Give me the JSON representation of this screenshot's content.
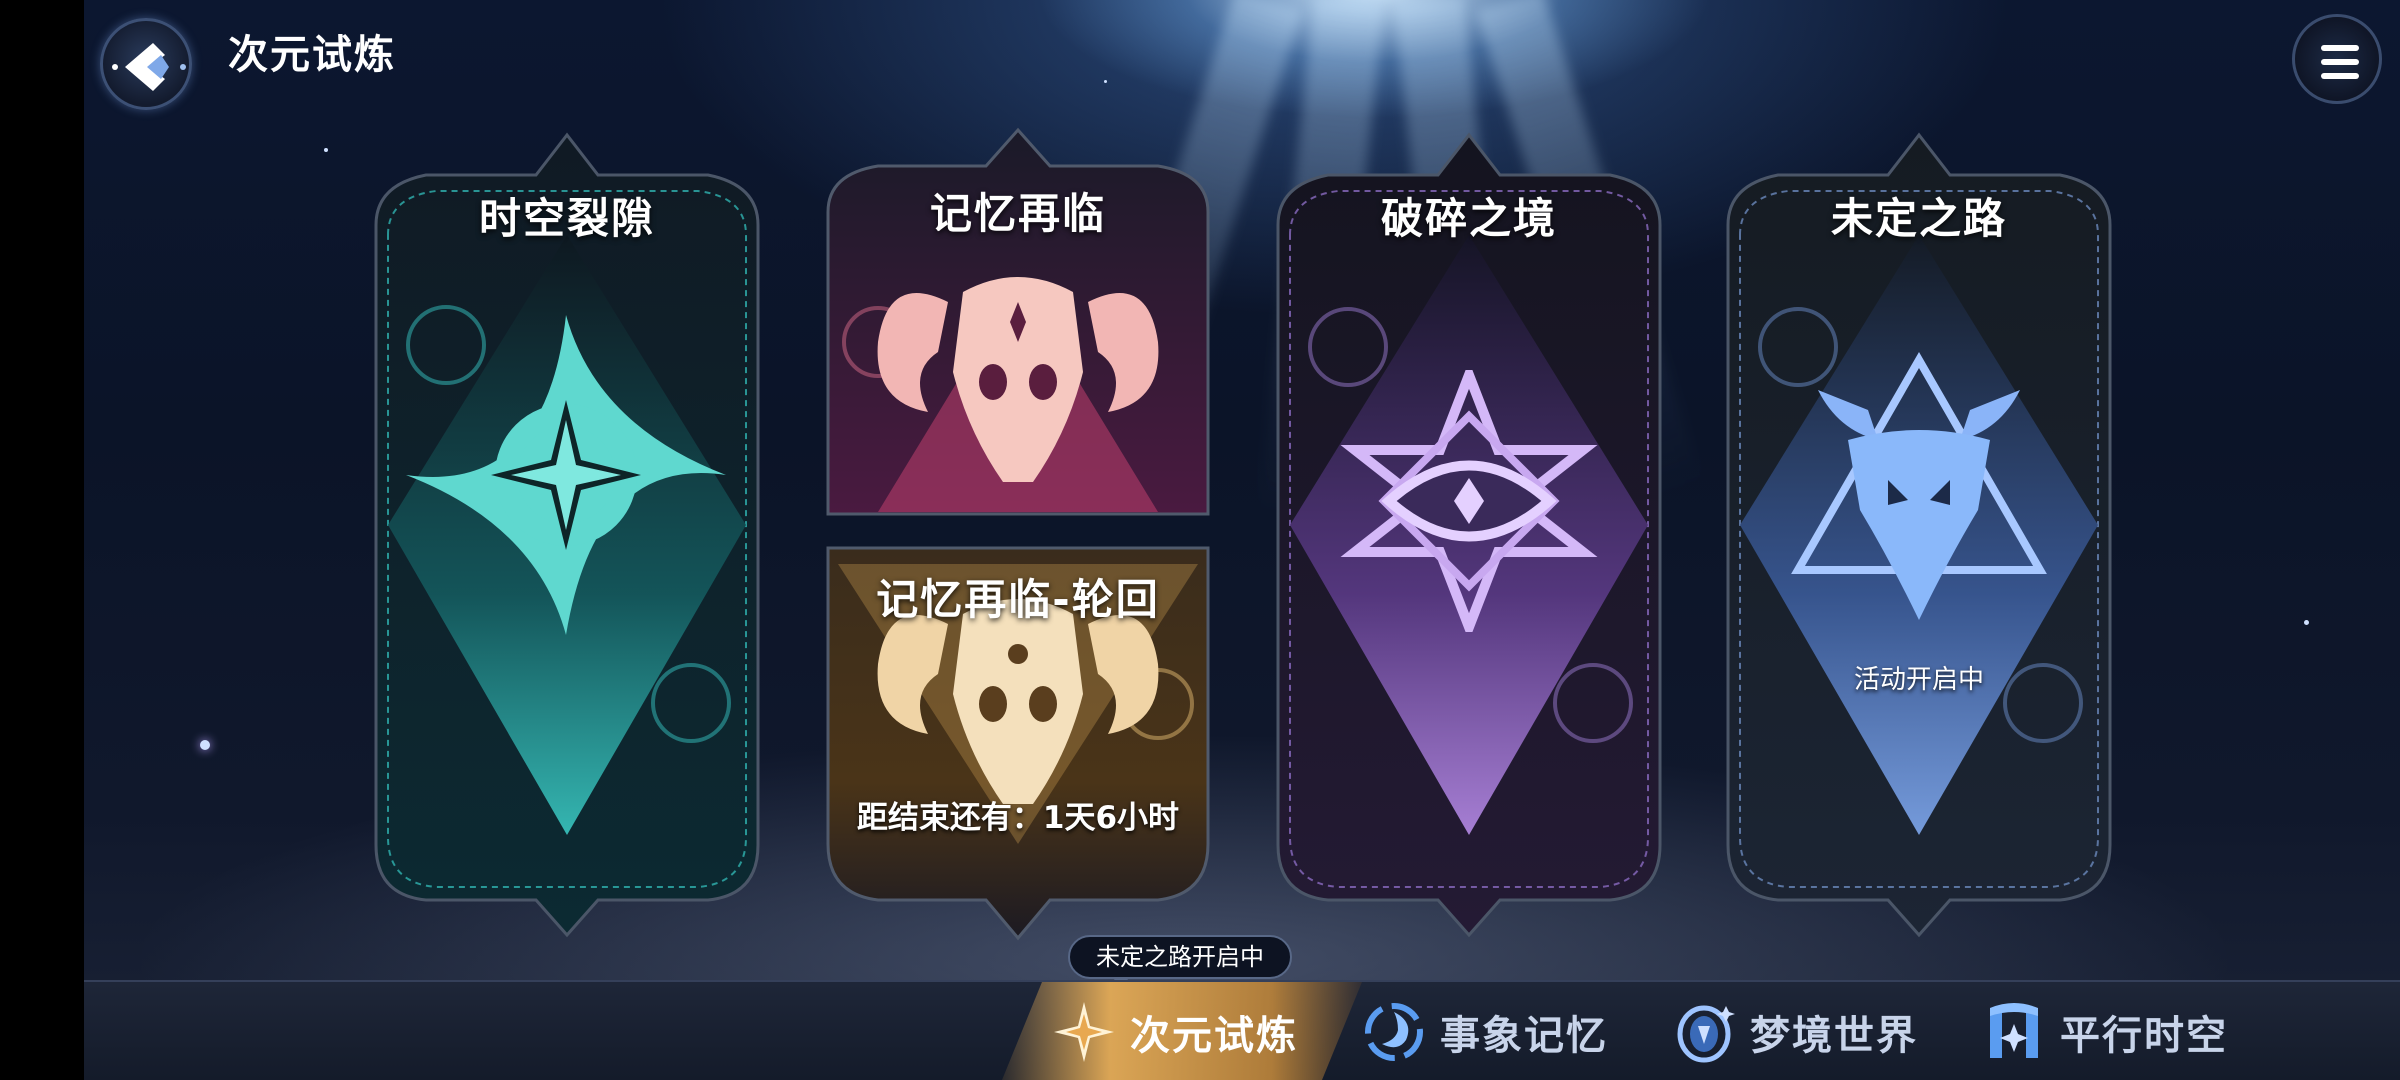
{
  "header": {
    "title": "次元试炼",
    "back_icon": "back-arrow-icon",
    "menu_icon": "hamburger-menu-icon"
  },
  "cards": {
    "rift": {
      "title": "时空裂隙",
      "accent": "#4fd6cc"
    },
    "memory": {
      "title": "记忆再临",
      "accent": "#e890a4"
    },
    "memory_cycle": {
      "title": "记忆再临-轮回",
      "countdown": "距结束还有：1天6小时",
      "accent": "#e8c890"
    },
    "broken": {
      "title": "破碎之境",
      "accent": "#b98ae8"
    },
    "undetermined": {
      "title": "未定之路",
      "status": "活动开启中",
      "accent": "#7fb0f2"
    }
  },
  "tooltip": {
    "text": "未定之路开启中"
  },
  "nav": {
    "items": [
      {
        "label": "次元试炼",
        "icon": "star-compass-icon",
        "active": true
      },
      {
        "label": "事象记忆",
        "icon": "swirl-icon",
        "active": false
      },
      {
        "label": "梦境世界",
        "icon": "dream-orb-icon",
        "active": false
      },
      {
        "label": "平行时空",
        "icon": "portal-gate-icon",
        "active": false
      }
    ],
    "active_color": "#f0b45a"
  }
}
